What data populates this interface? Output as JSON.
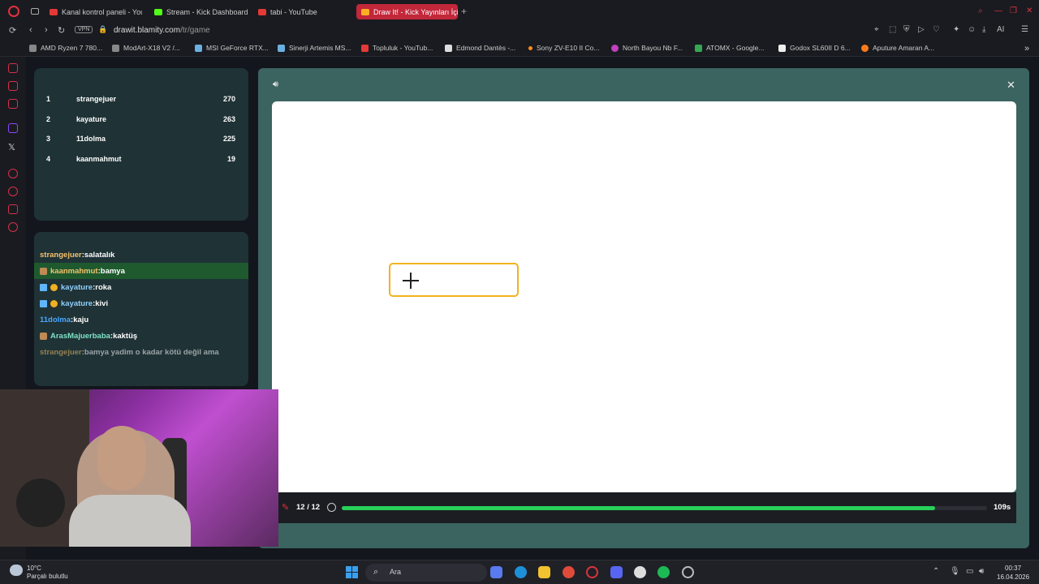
{
  "browser": {
    "tabs": [
      {
        "title": "Kanal kontrol paneli - YouT",
        "icon": "youtube-icon",
        "color": "#e53935"
      },
      {
        "title": "Stream - Kick Dashboard",
        "icon": "kick-icon",
        "color": "#53fc18"
      },
      {
        "title": "tabi - YouTube",
        "icon": "youtube-icon",
        "color": "#e53935"
      },
      {
        "title": "Draw It! - Kick Yayınları İçi",
        "icon": "drawit-icon",
        "color": "#ffb020"
      }
    ],
    "address": {
      "vpn": "VPN",
      "host": "drawit.blamity.com",
      "path": "/tr/game"
    },
    "bookmarks": [
      {
        "label": "AMD Ryzen 7 780...",
        "color": "#888"
      },
      {
        "label": "ModArt-X18 V2 /...",
        "color": "#888"
      },
      {
        "label": "MSI GeForce RTX...",
        "color": "#6ab0e0"
      },
      {
        "label": "Sinerji Artemis MS...",
        "color": "#6ab0e0"
      },
      {
        "label": "Topluluk - YouTub...",
        "color": "#e53935"
      },
      {
        "label": "Edmond Dantès -...",
        "color": "#ddd"
      },
      {
        "label": "Sony ZV-E10 II Co...",
        "color": "#ff8c1a"
      },
      {
        "label": "North Bayou Nb F...",
        "color": "#c040c0"
      },
      {
        "label": "ATOMX - Google...",
        "color": "#34a853"
      },
      {
        "label": "Godox SL60II D 6...",
        "color": "#eee"
      },
      {
        "label": "Aputure Amaran A...",
        "color": "#ff7a1a"
      }
    ]
  },
  "leaderboard": [
    {
      "rank": "1",
      "name": "strangejuer",
      "score": "270"
    },
    {
      "rank": "2",
      "name": "kayature",
      "score": "263"
    },
    {
      "rank": "3",
      "name": "11dolma",
      "score": "225"
    },
    {
      "rank": "4",
      "name": "kaanmahmut",
      "score": "19"
    }
  ],
  "chat": [
    {
      "user": "strangejuer",
      "msg": ":salatalık",
      "color": "#f5c26b",
      "badge": "",
      "highlight": false
    },
    {
      "user": "kaanmahmut",
      "msg": ":bamya",
      "color": "#f5c26b",
      "badge": "shield",
      "highlight": true
    },
    {
      "user": "kayature",
      "msg": ":roka",
      "color": "#8fd0ff",
      "badge": "sword-gold",
      "highlight": false
    },
    {
      "user": "kayature",
      "msg": ":kivi",
      "color": "#8fd0ff",
      "badge": "sword-gold",
      "highlight": false
    },
    {
      "user": "11dolma",
      "msg": ":kaju",
      "color": "#4aa8ff",
      "badge": "",
      "highlight": false
    },
    {
      "user": "ArasMajuerbaba",
      "msg": ":kaktüş",
      "color": "#7fe3c6",
      "badge": "shield",
      "highlight": false
    },
    {
      "user": "strangejuer",
      "msg": ":bamya yadim o kadar kötü değil ama",
      "color": "#f5c26b",
      "badge": "",
      "highlight": false
    }
  ],
  "game": {
    "round": "12 / 12",
    "time_left": "109s",
    "progress": 0.92,
    "drawing_color": "#f2b320"
  },
  "taskbar": {
    "weather_temp": "10°C",
    "weather_desc": "Parçalı bulutlu",
    "search_placeholder": "Ara",
    "time": "00:37",
    "date": "16.04.2026"
  }
}
